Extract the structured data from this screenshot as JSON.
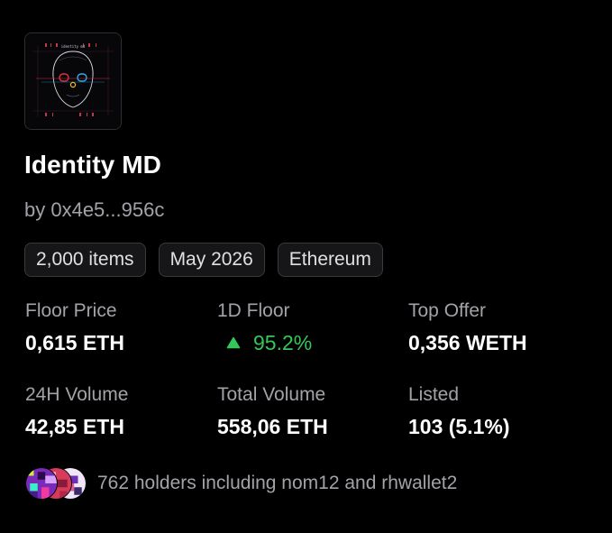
{
  "collection": {
    "name": "Identity MD",
    "creator_text": "by 0x4e5...956c",
    "thumbnail_text": "identity md"
  },
  "chips": [
    {
      "label": "2,000 items"
    },
    {
      "label": "May 2026"
    },
    {
      "label": "Ethereum"
    }
  ],
  "stats": {
    "floor_price": {
      "label": "Floor Price",
      "value": "0,615 ETH"
    },
    "floor_1d": {
      "label": "1D Floor",
      "value": "95.2%",
      "icon": "triangle-up-icon"
    },
    "top_offer": {
      "label": "Top Offer",
      "value": "0,356 WETH"
    },
    "volume_24h": {
      "label": "24H Volume",
      "value": "42,85 ETH"
    },
    "total_volume": {
      "label": "Total Volume",
      "value": "558,06 ETH"
    },
    "listed": {
      "label": "Listed",
      "value": "103 (5.1%)"
    }
  },
  "holders": {
    "text": "762 holders including nom12 and rhwallet2"
  },
  "colors": {
    "background": "#000000",
    "primary_text": "#ffffff",
    "secondary_text": "#a2a2a8",
    "positive": "#34c759",
    "chip_border": "#3a3a3e"
  }
}
